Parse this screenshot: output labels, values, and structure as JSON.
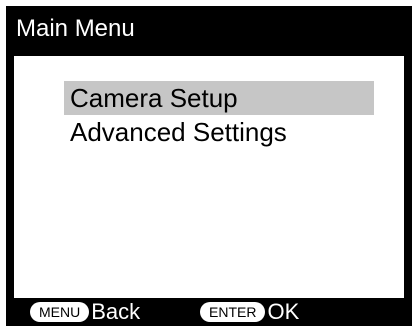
{
  "title": "Main Menu",
  "menu": {
    "items": [
      {
        "label": "Camera Setup",
        "selected": true
      },
      {
        "label": "Advanced Settings",
        "selected": false
      }
    ]
  },
  "footer": {
    "back": {
      "key": "MENU",
      "label": "Back"
    },
    "ok": {
      "key": "ENTER",
      "label": "OK"
    }
  },
  "colors": {
    "background": "#000000",
    "content": "#ffffff",
    "selection": "#c6c6c6",
    "text": "#000000"
  }
}
